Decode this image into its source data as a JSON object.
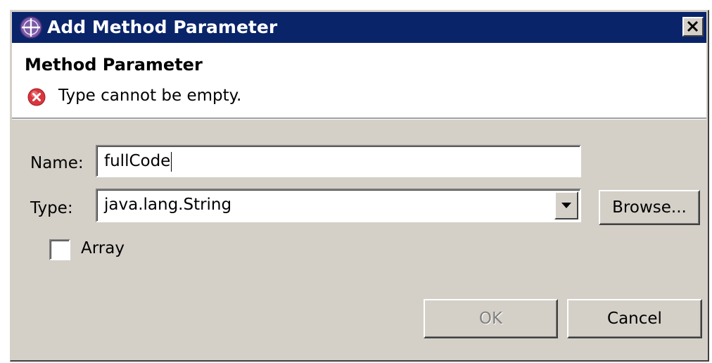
{
  "window": {
    "title": "Add Method Parameter",
    "close_label": "X"
  },
  "header": {
    "title": "Method Parameter",
    "error_message": "Type cannot be empty."
  },
  "form": {
    "name_label": "Name:",
    "name_value": "fullCode",
    "type_label": "Type:",
    "type_value": "java.lang.String",
    "browse_label": "Browse...",
    "array_label": "Array",
    "array_checked": false
  },
  "buttons": {
    "ok_label": "OK",
    "ok_enabled": false,
    "cancel_label": "Cancel"
  },
  "colors": {
    "titlebar": "#0a246a",
    "dialog_bg": "#d4d0c8",
    "header_bg": "#ffffff",
    "error_red": "#d9363e",
    "app_icon_purple": "#7b5aa6"
  },
  "icons": {
    "app": "window-app-icon",
    "error": "error-icon",
    "close": "close-icon",
    "dropdown": "chevron-down-icon"
  }
}
